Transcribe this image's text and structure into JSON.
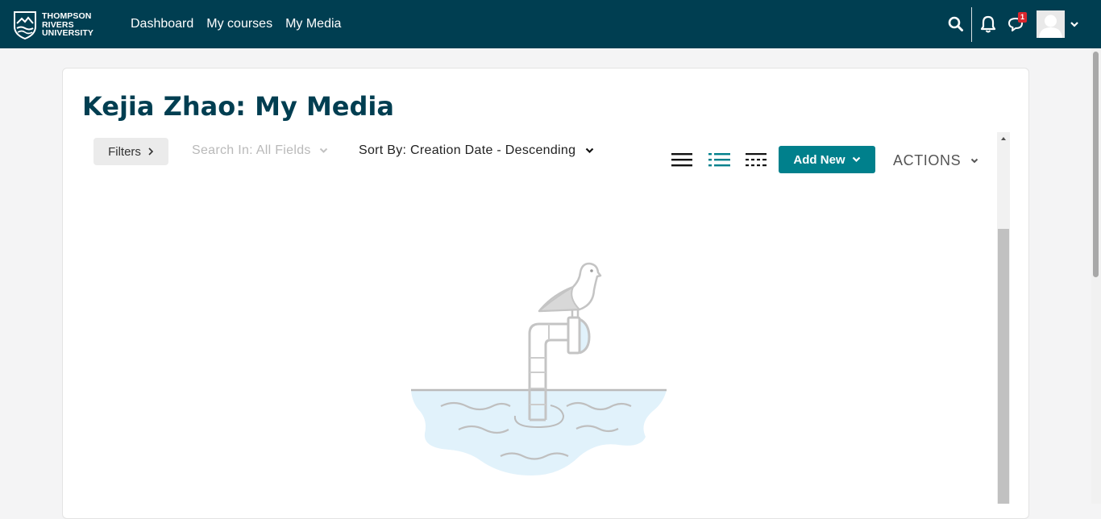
{
  "navbar": {
    "logo": {
      "line1": "THOMPSON",
      "line2": "RIVERS",
      "line3": "UNIVERSITY",
      "icon": "university-crest-icon"
    },
    "links": [
      "Dashboard",
      "My courses",
      "My Media"
    ],
    "icons": [
      "search-icon",
      "bell-icon",
      "message-icon",
      "user-avatar",
      "chevron-down-icon"
    ],
    "message_badge": "1",
    "background_color": "#003e51"
  },
  "page": {
    "title": "Kejia Zhao: My Media"
  },
  "toolbar": {
    "filters_label": "Filters",
    "search_in_label": "Search In: All Fields",
    "sort_by_label": "Sort By: Creation Date - Descending",
    "view_icons": [
      "detailed-view-icon",
      "list-view-icon",
      "compact-view-icon"
    ],
    "add_new_label": "Add New",
    "actions_label": "ACTIONS",
    "accent_color": "#00808c"
  },
  "empty_state": {
    "illustration": "seagull-periscope-illustration"
  }
}
